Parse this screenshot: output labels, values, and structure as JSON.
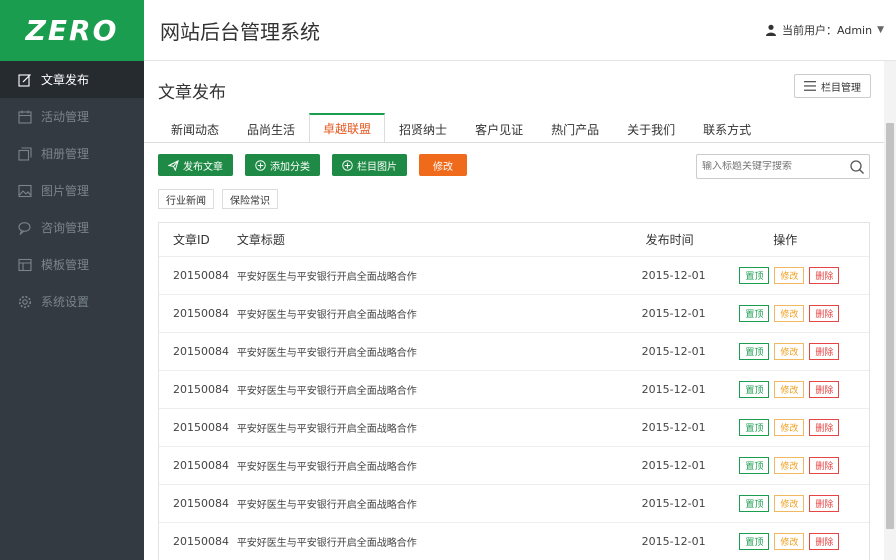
{
  "brand": {
    "logo_text": "ZERO",
    "accent": "#1a9d4e",
    "sidebar_bg": "#333a41"
  },
  "sidebar": {
    "items": [
      {
        "label": "文章发布",
        "icon": "edit-icon",
        "active": true
      },
      {
        "label": "活动管理",
        "icon": "calendar-icon",
        "active": false
      },
      {
        "label": "相册管理",
        "icon": "gallery-icon",
        "active": false
      },
      {
        "label": "图片管理",
        "icon": "image-icon",
        "active": false
      },
      {
        "label": "咨询管理",
        "icon": "chat-icon",
        "active": false
      },
      {
        "label": "模板管理",
        "icon": "template-icon",
        "active": false
      },
      {
        "label": "系统设置",
        "icon": "gear-icon",
        "active": false
      }
    ]
  },
  "header": {
    "title": "网站后台管理系统",
    "user_label": "当前用户：",
    "user_name": "Admin"
  },
  "main": {
    "page_title": "文章发布",
    "column_button": "栏目管理",
    "tabs": [
      {
        "label": "新闻动态",
        "active": false
      },
      {
        "label": "品尚生活",
        "active": false
      },
      {
        "label": "卓越联盟",
        "active": true
      },
      {
        "label": "招贤纳士",
        "active": false
      },
      {
        "label": "客户见证",
        "active": false
      },
      {
        "label": "热门产品",
        "active": false
      },
      {
        "label": "关于我们",
        "active": false
      },
      {
        "label": "联系方式",
        "active": false
      }
    ],
    "toolbar": {
      "publish": "发布文章",
      "add_category": "添加分类",
      "column_image": "栏目图片",
      "edit": "修改"
    },
    "search": {
      "placeholder": "输入标题关键字搜索"
    },
    "filter_tags": [
      "行业新闻",
      "保险常识"
    ],
    "table": {
      "headers": {
        "id": "文章ID",
        "title": "文章标题",
        "time": "发布时间",
        "actions": "操作"
      },
      "action_labels": {
        "top": "置顶",
        "edit": "修改",
        "delete": "删除"
      },
      "rows": [
        {
          "id": "20150084",
          "title": "平安好医生与平安银行开启全面战略合作",
          "time": "2015-12-01"
        },
        {
          "id": "20150084",
          "title": "平安好医生与平安银行开启全面战略合作",
          "time": "2015-12-01"
        },
        {
          "id": "20150084",
          "title": "平安好医生与平安银行开启全面战略合作",
          "time": "2015-12-01"
        },
        {
          "id": "20150084",
          "title": "平安好医生与平安银行开启全面战略合作",
          "time": "2015-12-01"
        },
        {
          "id": "20150084",
          "title": "平安好医生与平安银行开启全面战略合作",
          "time": "2015-12-01"
        },
        {
          "id": "20150084",
          "title": "平安好医生与平安银行开启全面战略合作",
          "time": "2015-12-01"
        },
        {
          "id": "20150084",
          "title": "平安好医生与平安银行开启全面战略合作",
          "time": "2015-12-01"
        },
        {
          "id": "20150084",
          "title": "平安好医生与平安银行开启全面战略合作",
          "time": "2015-12-01"
        }
      ]
    }
  }
}
